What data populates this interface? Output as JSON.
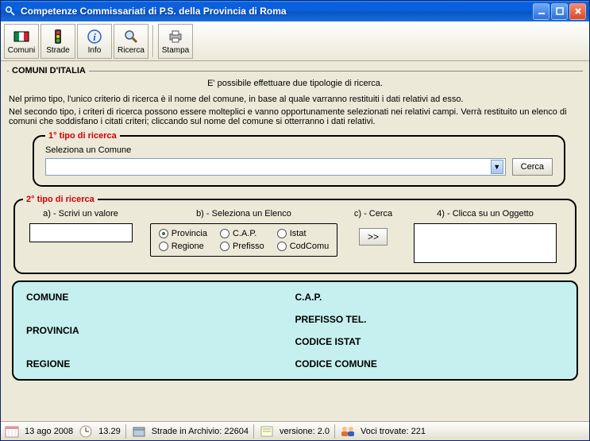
{
  "window": {
    "title": "Competenze Commissariati di P.S. della Provincia di Roma"
  },
  "toolbar": {
    "comuni": "Comuni",
    "strade": "Strade",
    "info": "Info",
    "ricerca": "Ricerca",
    "stampa": "Stampa"
  },
  "mainGroup": {
    "legend": "COMUNI D'ITALIA",
    "intro": "E' possibile effettuare due tipologie di ricerca.",
    "para1": "Nel primo tipo, l'unico criterio di ricerca è il nome del comune, in base al quale varranno restituiti i dati relativi ad esso.",
    "para2": "Nel secondo tipo, i criteri di ricerca possono essere molteplici e vanno opportunamente selezionati nei relativi campi. Verrà restituito un elenco di comuni che soddisfano i citati criteri; cliccando sul nome del comune si otterranno i dati relativi."
  },
  "tipo1": {
    "legend": "1° tipo di ricerca",
    "label": "Seleziona un Comune",
    "comboValue": "",
    "cerca": "Cerca"
  },
  "tipo2": {
    "legend": "2° tipo di ricerca",
    "colA": "a) - Scrivi un valore",
    "colB": "b) - Seleziona un Elenco",
    "colC": "c) - Cerca",
    "colD": "4) - Clicca su un Oggetto",
    "valore": "",
    "radios": {
      "provincia": "Provincia",
      "cap": "C.A.P.",
      "istat": "Istat",
      "regione": "Regione",
      "prefisso": "Prefisso",
      "codcomu": "CodComu"
    },
    "searchSymbol": ">>"
  },
  "results": {
    "comune": "COMUNE",
    "cap": "C.A.P.",
    "provincia": "PROVINCIA",
    "prefisso": "PREFISSO TEL.",
    "regione": "REGIONE",
    "codistat": "CODICE ISTAT",
    "codcomune": "CODICE COMUNE"
  },
  "status": {
    "date": "13 ago 2008",
    "time": "13.29",
    "archivio": "Strade in Archivio: 22604",
    "versione": "versione: 2.0",
    "voci": "Voci trovate: 221"
  }
}
